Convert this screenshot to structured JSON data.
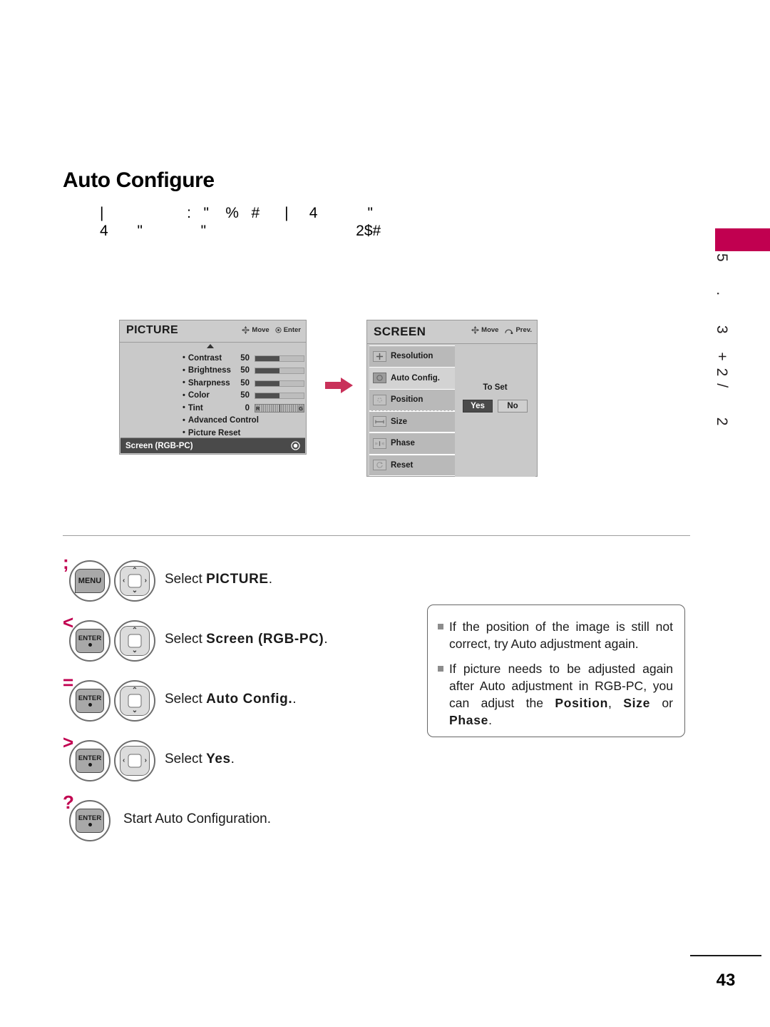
{
  "page": {
    "title": "Auto Configure",
    "intro_paragraph": "|                    :   \"    %   #      |     4            \"\n4       \"              \"                                    2$#",
    "number": "43",
    "side_tab_label": "5  .  3 +2/  2",
    "accent_color": "#C10050"
  },
  "picture_osd": {
    "title": "PICTURE",
    "hints": [
      {
        "icon": "dpad-icon",
        "label": "Move"
      },
      {
        "icon": "enter-dot-icon",
        "label": "Enter"
      }
    ],
    "items": [
      {
        "label": "Contrast",
        "value": "50",
        "control": "slider",
        "fill": 50
      },
      {
        "label": "Brightness",
        "value": "50",
        "control": "slider",
        "fill": 50
      },
      {
        "label": "Sharpness",
        "value": "50",
        "control": "slider",
        "fill": 50
      },
      {
        "label": "Color",
        "value": "50",
        "control": "slider",
        "fill": 50
      },
      {
        "label": "Tint",
        "value": "0",
        "control": "tint",
        "left_mark": "R",
        "right_mark": "G"
      },
      {
        "label": "Advanced Control",
        "value": "",
        "control": "none"
      },
      {
        "label": "Picture Reset",
        "value": "",
        "control": "none"
      }
    ],
    "footer_bar": {
      "label": "Screen (RGB-PC)",
      "icon": "radio-dot-icon"
    }
  },
  "screen_osd": {
    "title": "SCREEN",
    "hints": [
      {
        "icon": "dpad-icon",
        "label": "Move"
      },
      {
        "icon": "return-arrow-icon",
        "label": "Prev."
      }
    ],
    "items": [
      {
        "label": "Resolution",
        "icon": "plus-box-icon",
        "selected": false
      },
      {
        "label": "Auto Config.",
        "icon": "circle-box-icon",
        "selected": true
      },
      {
        "label": "Position",
        "icon": "move-box-icon",
        "selected": false
      },
      {
        "label": "Size",
        "icon": "width-box-icon",
        "selected": false
      },
      {
        "label": "Phase",
        "icon": "phase-box-icon",
        "selected": false
      },
      {
        "label": "Reset",
        "icon": "reset-box-icon",
        "selected": false
      }
    ],
    "dialog": {
      "prompt": "To Set",
      "yes_label": "Yes",
      "no_label": "No",
      "selected": "Yes"
    }
  },
  "flow_arrow": {
    "icon": "right-arrow-icon",
    "color": "#C9315A"
  },
  "steps": [
    {
      "num": ";",
      "keys": [
        "MENU",
        "dpad-4way"
      ],
      "text_prefix": "Select ",
      "text_bold": "PICTURE",
      "text_suffix": "."
    },
    {
      "num": "<",
      "keys": [
        "ENTER",
        "dpad-updown"
      ],
      "text_prefix": "Select ",
      "text_bold": "Screen (RGB-PC)",
      "text_suffix": "."
    },
    {
      "num": "=",
      "keys": [
        "ENTER",
        "dpad-updown"
      ],
      "text_prefix": "Select ",
      "text_bold": "Auto Config.",
      "text_suffix": "."
    },
    {
      "num": ">",
      "keys": [
        "ENTER",
        "dpad-leftright"
      ],
      "text_prefix": "Select ",
      "text_bold": "Yes",
      "text_suffix": "."
    },
    {
      "num": "?",
      "keys": [
        "ENTER"
      ],
      "text_prefix": "Start Auto Configuration.",
      "text_bold": "",
      "text_suffix": ""
    }
  ],
  "keys": {
    "menu_label": "MENU",
    "enter_label": "ENTER"
  },
  "note_box": {
    "items": [
      {
        "parts": [
          {
            "t": "If the position of the image is still not correct, try Auto adjustment again.",
            "b": false
          }
        ]
      },
      {
        "parts": [
          {
            "t": "If picture needs to be adjusted again after Auto adjustment in RGB-PC, you can adjust the ",
            "b": false
          },
          {
            "t": "Position",
            "b": true
          },
          {
            "t": ", ",
            "b": false
          },
          {
            "t": "Size",
            "b": true
          },
          {
            "t": " or ",
            "b": false
          },
          {
            "t": "Phase",
            "b": true
          },
          {
            "t": ".",
            "b": false
          }
        ]
      }
    ]
  }
}
